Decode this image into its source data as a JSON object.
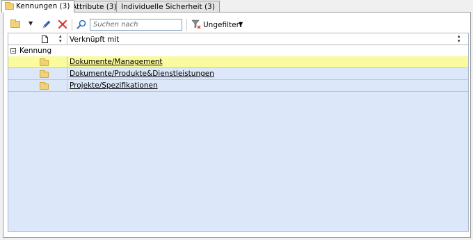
{
  "tabs": [
    {
      "label": "Kennungen (3)",
      "active": true
    },
    {
      "label": "Attribute (3)",
      "active": false
    },
    {
      "label": "Individuelle Sicherheit (3)",
      "active": false
    }
  ],
  "toolbar": {
    "new_icon": "folder-icon",
    "edit_icon": "pencil-icon",
    "delete_icon": "delete-x-icon",
    "search_icon": "magnifier-icon",
    "search_placeholder": "Suchen nach",
    "filter_icon": "filter-icon",
    "filter_label": "Ungefiltert"
  },
  "grid": {
    "column_header": "Verknüpft mit",
    "group_label": "Kennung",
    "rows": [
      {
        "label": "Dokumente/Management",
        "selected": true
      },
      {
        "label": "Dokumente/Produkte&Dienstleistungen",
        "selected": false
      },
      {
        "label": "Projekte/Spezifikationen",
        "selected": false
      }
    ]
  },
  "colors": {
    "grid_background": "#dce8f9",
    "selected_row": "#fafa9e",
    "folder": "#f1d17a",
    "delete": "#d9342b",
    "pencil": "#2f6fc4"
  }
}
